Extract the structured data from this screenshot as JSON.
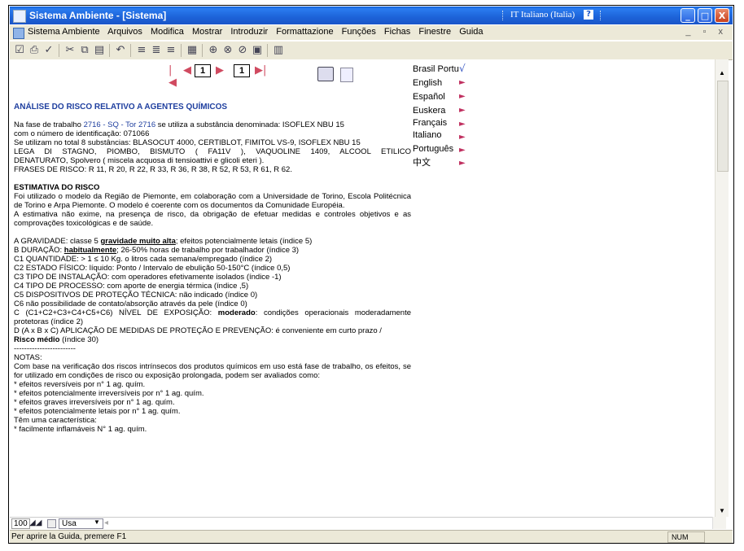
{
  "window": {
    "title": "Sistema Ambiente - [Sistema]",
    "ime_language": "IT Italiano (Italia)",
    "help_glyph": "?",
    "minimize": "_",
    "maximize": "□",
    "close": "X"
  },
  "menu": {
    "items": [
      "Sistema Ambiente",
      "Arquivos",
      "Modifica",
      "Mostrar",
      "Introduzir",
      "Formattazione",
      "Funções",
      "Fichas",
      "Finestre",
      "Guida"
    ],
    "mdi_controls": "_ ▫ x"
  },
  "nav": {
    "first": "|◀",
    "prev": "◀",
    "page": "1",
    "next": "▶",
    "page2": "1",
    "last": "▶|"
  },
  "languages": [
    {
      "label": "Brasil Portu",
      "selected": true,
      "mark": "√"
    },
    {
      "label": "English",
      "mark": "►"
    },
    {
      "label": "Español",
      "mark": "►"
    },
    {
      "label": "Euskera",
      "mark": "►"
    },
    {
      "label": "Français",
      "mark": "►"
    },
    {
      "label": "Italiano",
      "mark": "►"
    },
    {
      "label": "Português",
      "mark": "►"
    },
    {
      "label": "中文",
      "mark": "►"
    }
  ],
  "doc": {
    "heading": "ANÁLISE DO RISCO RELATIVO A AGENTES QUÍMICOS",
    "intro_pre": "Na fase de trabalho",
    "intro_phase": "2716 - SQ - Tor 2716",
    "intro_post": "se utiliza a substância denominada: ISOFLEX NBU 15",
    "intro_line2": "com o número de identificação: 071066",
    "intro_line3": "Se utilizam no total 8 substâncias: BLASOCUT 4000, CERTIBLOT, FIMITOL VS-9, ISOFLEX NBU 15",
    "intro_line4": "LEGA DI STAGNO, PIOMBO, BISMUTO ( FA11V ), VAQUOLINE 1409, ALCOOL ETILICO",
    "intro_line5": "DENATURATO, Spolvero ( miscela acquosa di tensioattivi e glicoli eteri ).",
    "intro_line6": "FRASES DE RISCO: R 11, R 20, R 22, R 33, R 36, R 38, R 52, R 53, R 61, R 62.",
    "estimate_title": "ESTIMATIVA DO RISCO",
    "estimate_p1": "Foi utilizado o modelo da Região de Piemonte, em colaboração com a Universidade de Torino, Escola Politécnica de Torino e Arpa Piemonte. O modelo é coerente com os documentos da Comunidade Européia.",
    "estimate_p2": "A estimativa não exime, na presença de risco, da obrigação de efetuar medidas e controles objetivos e as comprovações toxicológicas e de saúde.",
    "a_pre": "A GRAVIDADE: classe 5",
    "a_em": "gravidade muito alta",
    "a_post": "; efeitos potencialmente letais (índice 5)",
    "b_pre": "B DURAÇÃO:",
    "b_em": "habitualmente",
    "b_post": "; 26-50% horas de trabalho por trabalhador (índice 3)",
    "c1": "C1 QUANTIDADE: > 1 ≤ 10 Kg. o litros cada semana/empregado (índice 2)",
    "c2": "C2 ESTADO FÍSICO: líquido: Ponto / Intervalo de ebulição 50-150°C (índice 0,5)",
    "c3": "C3 TIPO DE INSTALAÇÃO: com operadores efetivamente isolados (índice -1)",
    "c4": "C4 TIPO DE PROCESSO: com aporte de energia térmica (índice ,5)",
    "c5": "C5 DISPOSITIVOS DE PROTEÇÃO TÉCNICA: não indicado (índice 0)",
    "c6": "C6 não possibilidade de contato/absorção através da pele (índice 0)",
    "c_pre": "C (C1+C2+C3+C4+C5+C6) NÍVEL DE EXPOSIÇÃO:",
    "c_em": "moderado",
    "c_post": ": condições operacionais moderadamente protetoras (índice 2)",
    "d_line": "D (A x B x C) APLICAÇÃO DE MEDIDAS DE PROTEÇÃO E PREVENÇÃO: é conveniente em curto prazo /",
    "d_em": "Risco médio",
    "d_post": "(índice 30)",
    "separator": "------------------------",
    "notes_title": "NOTAS:",
    "notes_p": "Com base na verificação dos riscos intrínsecos dos produtos químicos em uso está fase de trabalho, os efeitos, se for utilizado em condições de risco ou exposição prolongada, podem ser avaliados como:",
    "notes_items": [
      "* efeitos reversíveis por n° 1 ag. quím.",
      "* efeitos potencialmente irreversíveis por n° 1 ag. quím.",
      "* efeitos graves irreversíveis por n° 1 ag. quím.",
      "* efeitos potencialmente letais por n° 1 ag. quím."
    ],
    "char_title": "Têm uma característica:",
    "char_item": "* facilmente inflamáveis N° 1 ag. quím."
  },
  "bottom": {
    "zoom": "100",
    "style": "Usa"
  },
  "status": {
    "message": "Per aprire la Guida, premere F1",
    "num": "NUM"
  }
}
